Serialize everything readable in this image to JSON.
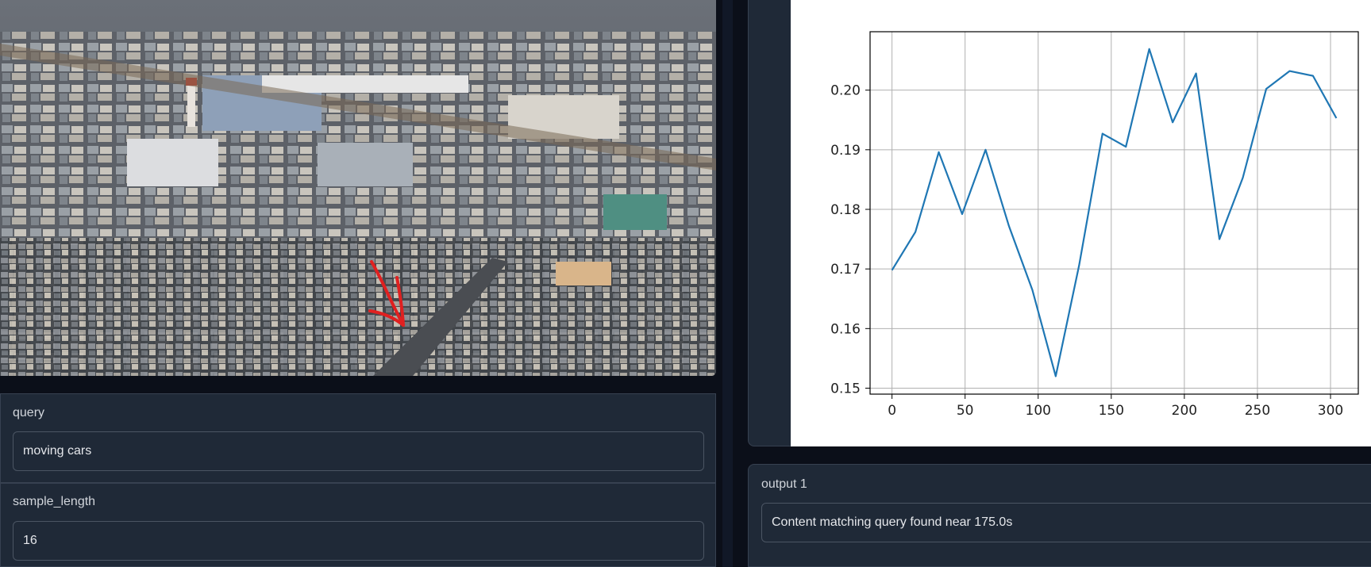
{
  "inputs": {
    "query_label": "query",
    "query_value": "moving cars",
    "sample_length_label": "sample_length",
    "sample_length_value": "16"
  },
  "output": {
    "label": "output 1",
    "text": "Content matching query found near 175.0s"
  },
  "colors": {
    "line": "#1f77b4",
    "annotation_arrow": "#e02020"
  },
  "chart_data": {
    "type": "line",
    "x": [
      0,
      16,
      32,
      48,
      64,
      80,
      96,
      112,
      128,
      144,
      160,
      176,
      192,
      208,
      224,
      240,
      256,
      272,
      288,
      304
    ],
    "series": [
      {
        "values": [
          0.1698,
          0.1762,
          0.1896,
          0.1792,
          0.19,
          0.1772,
          0.1665,
          0.152,
          0.1706,
          0.1927,
          0.1905,
          0.2069,
          0.1946,
          0.2028,
          0.175,
          0.1853,
          0.2002,
          0.2032,
          0.2024,
          0.1953
        ]
      }
    ],
    "xticks": [
      "0",
      "50",
      "100",
      "150",
      "200",
      "250",
      "300"
    ],
    "yticks": [
      "0.15",
      "0.16",
      "0.17",
      "0.18",
      "0.19",
      "0.20"
    ],
    "xlim": [
      -15,
      319
    ],
    "ylim": [
      0.149,
      0.2098
    ],
    "grid": true
  }
}
